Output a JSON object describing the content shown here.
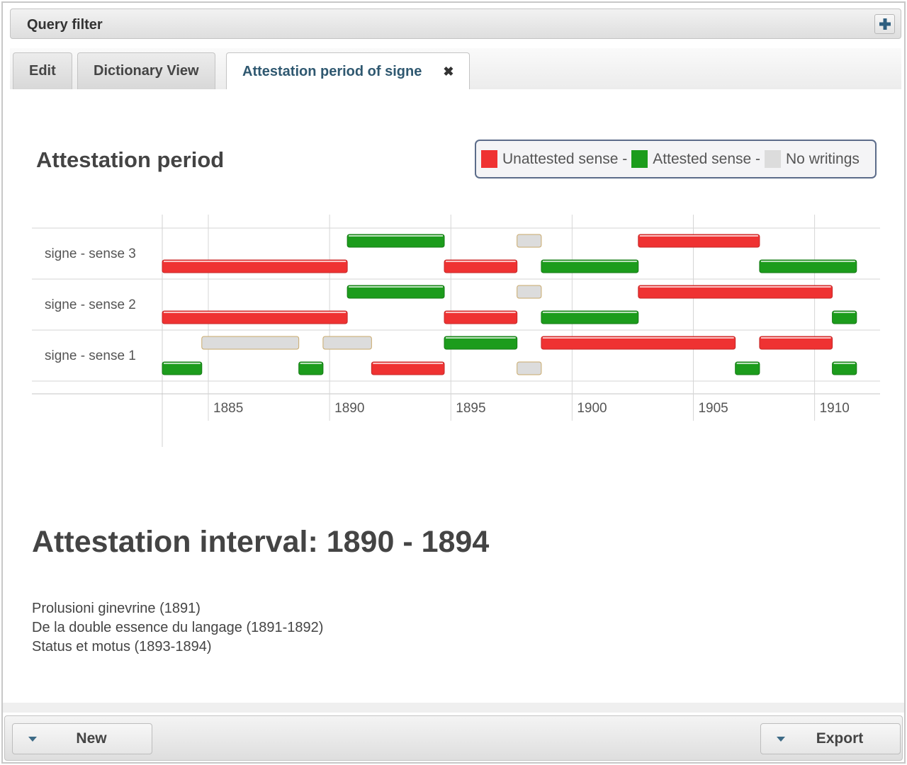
{
  "header": {
    "title": "Query filter",
    "add_icon": "plus-icon"
  },
  "tabs": [
    {
      "label": "Edit",
      "active": false
    },
    {
      "label": "Dictionary View",
      "active": false
    },
    {
      "label": "Attestation period of signe",
      "active": true,
      "close_icon": "close-icon"
    }
  ],
  "legend": {
    "items": [
      {
        "label": "Unattested sense -",
        "color": "#ef3232"
      },
      {
        "label": "Attested sense -",
        "color": "#1c9c1c"
      },
      {
        "label": "No writings",
        "color": "#dcdcdc"
      }
    ]
  },
  "chart_data": {
    "type": "timeline",
    "title": "Attestation period",
    "xlabel": "",
    "ylabel": "",
    "x_ticks": [
      1885,
      1890,
      1895,
      1900,
      1905,
      1910
    ],
    "xlim": [
      1883.1,
      1912.7
    ],
    "grid": true,
    "legend_position": "top-right",
    "colors": {
      "unattested": "#ef3232",
      "attested": "#1c9c1c",
      "nowritings": "#dcdcdc"
    },
    "rows": [
      {
        "label": "signe - sense 3",
        "lanes": [
          [
            {
              "type": "attested",
              "start": 1891,
              "end": 1895
            },
            {
              "type": "nowritings",
              "start": 1898,
              "end": 1899
            },
            {
              "type": "unattested",
              "start": 1903,
              "end": 1908
            }
          ],
          [
            {
              "type": "unattested",
              "start": 1883,
              "end": 1891
            },
            {
              "type": "unattested",
              "start": 1895,
              "end": 1898
            },
            {
              "type": "attested",
              "start": 1899,
              "end": 1903
            },
            {
              "type": "attested",
              "start": 1908,
              "end": 1912
            }
          ]
        ]
      },
      {
        "label": "signe - sense 2",
        "lanes": [
          [
            {
              "type": "attested",
              "start": 1891,
              "end": 1895
            },
            {
              "type": "nowritings",
              "start": 1898,
              "end": 1899
            },
            {
              "type": "unattested",
              "start": 1903,
              "end": 1911
            }
          ],
          [
            {
              "type": "unattested",
              "start": 1883,
              "end": 1891
            },
            {
              "type": "unattested",
              "start": 1895,
              "end": 1898
            },
            {
              "type": "attested",
              "start": 1899,
              "end": 1903
            },
            {
              "type": "attested",
              "start": 1911,
              "end": 1912
            }
          ]
        ]
      },
      {
        "label": "signe - sense 1",
        "lanes": [
          [
            {
              "type": "nowritings",
              "start": 1885,
              "end": 1889
            },
            {
              "type": "nowritings",
              "start": 1890,
              "end": 1892
            },
            {
              "type": "attested",
              "start": 1895,
              "end": 1898
            },
            {
              "type": "unattested",
              "start": 1899,
              "end": 1907
            },
            {
              "type": "unattested",
              "start": 1908,
              "end": 1911
            }
          ],
          [
            {
              "type": "attested",
              "start": 1883,
              "end": 1885
            },
            {
              "type": "attested",
              "start": 1889,
              "end": 1890
            },
            {
              "type": "unattested",
              "start": 1892,
              "end": 1895
            },
            {
              "type": "nowritings",
              "start": 1898,
              "end": 1899
            },
            {
              "type": "attested",
              "start": 1907,
              "end": 1908
            },
            {
              "type": "attested",
              "start": 1911,
              "end": 1912
            }
          ]
        ]
      }
    ]
  },
  "interval": {
    "title": "Attestation interval: 1890 - 1894"
  },
  "works": [
    "Prolusioni ginevrine (1891)",
    "De la double essence du langage (1891-1892)",
    "Status et motus (1893-1894)"
  ],
  "footer": {
    "new_label": "New",
    "export_label": "Export",
    "caret_icon": "caret-down-icon"
  }
}
